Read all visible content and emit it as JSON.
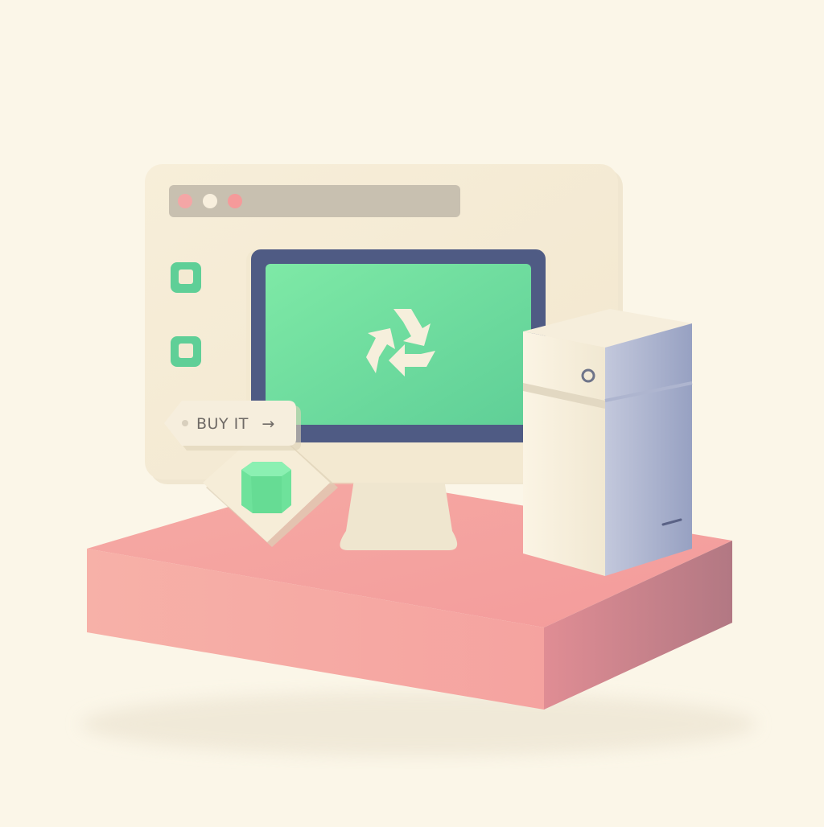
{
  "browser_window": {
    "controls": [
      "close-dot",
      "minimize-dot",
      "maximize-dot"
    ],
    "sidebar_items": [
      {
        "icon": "checkbox-icon"
      },
      {
        "icon": "checkbox-icon"
      }
    ]
  },
  "monitor": {
    "screen_icon": "recycle-icon"
  },
  "buy_tag": {
    "label": "BUY IT",
    "arrow": "→"
  },
  "product_card": {
    "icon": "hexagon-prism-icon"
  },
  "server_tower": {
    "icon": "power-button-icon"
  },
  "colors": {
    "background": "#fbf6e8",
    "platform": "#f4a0a0",
    "screen": "#74e2a0",
    "accent_green": "#6ee29b",
    "cream": "#f4ead2",
    "bezel": "#4f5b84"
  }
}
